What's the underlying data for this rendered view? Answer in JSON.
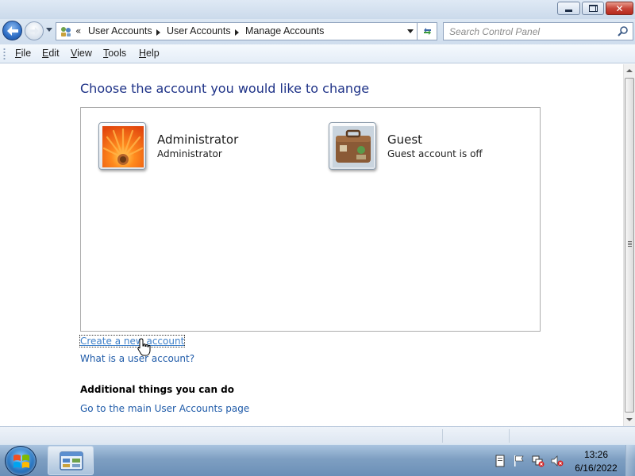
{
  "window": {
    "caption_buttons": {
      "minimize": "minimize",
      "maximize": "restore",
      "close": "✕"
    }
  },
  "address_bar": {
    "overflow_chevron": "«",
    "breadcrumbs": [
      "User Accounts",
      "User Accounts",
      "Manage Accounts"
    ],
    "icon": "control-panel-icon"
  },
  "search": {
    "placeholder": "Search Control Panel",
    "icon": "search-icon"
  },
  "menu": {
    "items": [
      {
        "label": "File",
        "accel": "F",
        "rest": "ile"
      },
      {
        "label": "Edit",
        "accel": "E",
        "rest": "dit"
      },
      {
        "label": "View",
        "accel": "V",
        "rest": "iew"
      },
      {
        "label": "Tools",
        "accel": "T",
        "rest": "ools"
      },
      {
        "label": "Help",
        "accel": "H",
        "rest": "elp"
      }
    ]
  },
  "main": {
    "heading": "Choose the account you would like to change",
    "accounts": [
      {
        "name": "Administrator",
        "type": "Administrator",
        "picture": "orange-flower-picture"
      },
      {
        "name": "Guest",
        "type": "Guest account is off",
        "picture": "suitcase-picture"
      }
    ],
    "links": {
      "create": "Create a new account",
      "what_is": "What is a user account?",
      "main_page": "Go to the main User Accounts page"
    },
    "additional_heading": "Additional things you can do"
  },
  "taskbar": {
    "time": "13:26",
    "date": "6/16/2022",
    "tray_icons": [
      "action-center-icon",
      "flag-icon",
      "network-disconnected-icon",
      "volume-muted-icon"
    ]
  },
  "colors": {
    "heading": "#1e3287",
    "link": "#1e5aa8",
    "taskbar": "#7e9fc2",
    "titlebar": "#cbdaeb"
  }
}
